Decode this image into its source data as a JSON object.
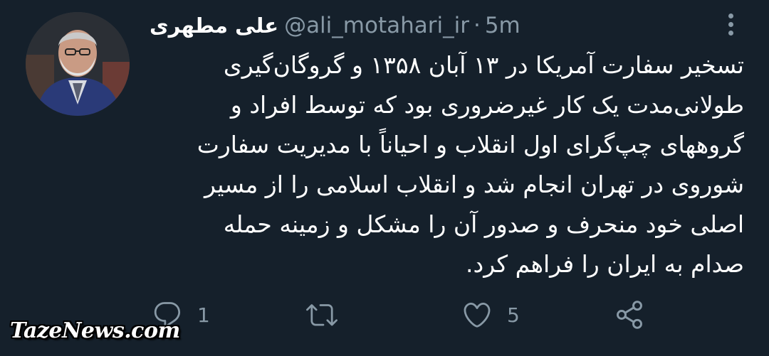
{
  "tweet": {
    "author_name": "علی مطهری",
    "handle": "@ali_motahari_ir",
    "separator": "·",
    "time": "5m",
    "text": "تسخیر سفارت آمریکا در ۱۳ آبان ۱۳۵۸ و گروگان‌گیری\nطولانی‌مدت یک کار غیرضروری بود که توسط افراد و\nگروههای چپ‌گرای اول انقلاب و احیاناً با مدیریت سفارت\nشوروی در تهران انجام شد و انقلاب اسلامی را از مسیر\nاصلی خود منحرف و صدور آن را مشکل و زمینه حمله\nصدام به ایران را فراهم کرد.",
    "more_icon": "more-vertical-icon"
  },
  "actions": {
    "reply": {
      "icon": "reply-icon",
      "count": "1"
    },
    "retweet": {
      "icon": "retweet-icon",
      "count": ""
    },
    "like": {
      "icon": "heart-icon",
      "count": "5"
    },
    "share": {
      "icon": "share-icon",
      "count": ""
    }
  },
  "watermark": "TazeNews.com",
  "colors": {
    "background": "#15202b",
    "text": "#ffffff",
    "secondary": "#8899a6"
  }
}
